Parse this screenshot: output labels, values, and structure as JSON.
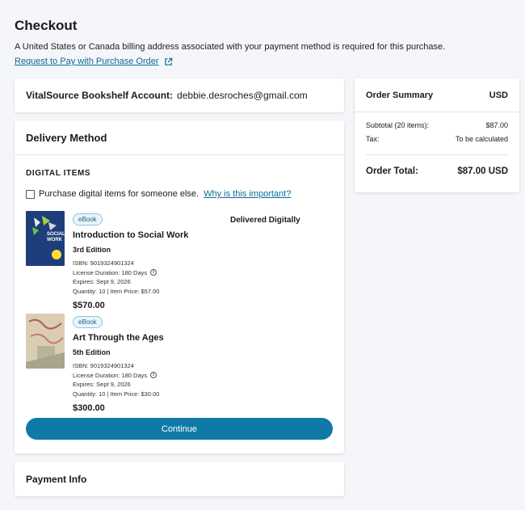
{
  "page": {
    "title": "Checkout",
    "notice": "A United States or Canada billing address associated with your payment method is required for this purchase.",
    "po_link": "Request to Pay with Purchase Order"
  },
  "account": {
    "label": "VitalSource Bookshelf Account:",
    "email": "debbie.desroches@gmail.com"
  },
  "delivery": {
    "title": "Delivery Method",
    "section_label": "DIGITAL ITEMS",
    "gift_label": "Purchase digital items for someone else.",
    "why_link": "Why is this important?",
    "delivered_label": "Delivered Digitally",
    "items": [
      {
        "badge": "eBook",
        "title": "Introduction to Social Work",
        "edition": "3rd Edition",
        "isbn": "ISBN: 9019324901324",
        "license": "License Duration: 180 Days",
        "expires": "Expires: Sept 9, 2026",
        "qty_price": "Quantity: 10  |  Item Price: $57.00",
        "price": "$570.00",
        "cover_text": "SOCIAL WORK",
        "cover_color": "#1d3e7a"
      },
      {
        "badge": "eBook",
        "title": "Art Through the Ages",
        "edition": "5th Edition",
        "isbn": "ISBN: 9019324901324",
        "license": "License Duration: 180 Days",
        "expires": "Expires: Sept 9, 2026",
        "qty_price": "Quantity: 10  |  Item Price: $30.00",
        "price": "$300.00",
        "cover_color": "#d9cdb6"
      }
    ],
    "continue_label": "Continue"
  },
  "payment": {
    "title": "Payment Info"
  },
  "summary": {
    "title": "Order Summary",
    "currency": "USD",
    "subtotal_label": "Subtotal (20 items):",
    "subtotal_value": "$87.00",
    "tax_label": "Tax:",
    "tax_value": "To be calculated",
    "total_label": "Order Total:",
    "total_value": "$87.00 USD"
  },
  "colors": {
    "accent": "#0f7aa8",
    "link": "#0c6b96",
    "background": "#f5f6fa"
  }
}
